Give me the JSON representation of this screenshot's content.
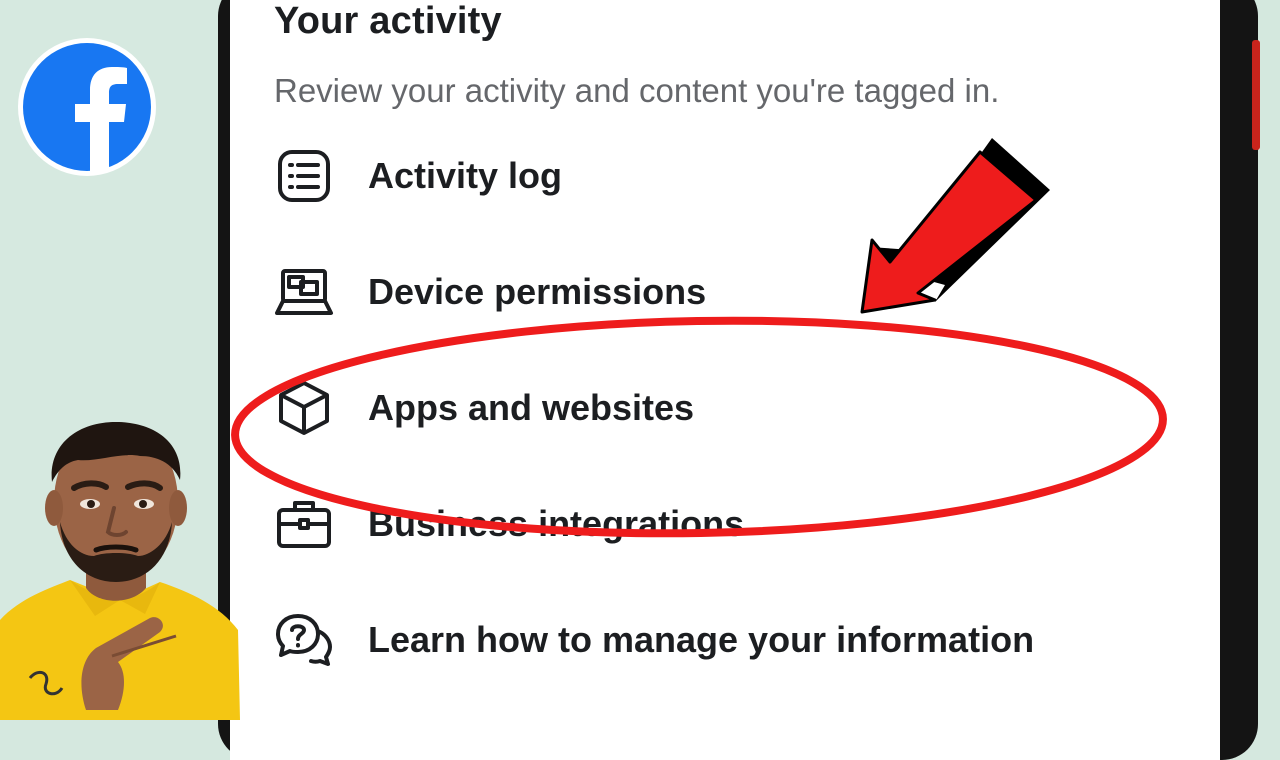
{
  "section": {
    "title": "Your activity",
    "subtitle": "Review your activity and content you're tagged in."
  },
  "menu": {
    "items": [
      {
        "label": "Activity log",
        "icon": "list-icon"
      },
      {
        "label": "Device permissions",
        "icon": "laptop-icon"
      },
      {
        "label": "Apps and websites",
        "icon": "cube-icon"
      },
      {
        "label": "Business integrations",
        "icon": "briefcase-icon"
      },
      {
        "label": "Learn how to manage your information",
        "icon": "question-chat-icon"
      }
    ]
  },
  "overlay": {
    "logo": "facebook-logo",
    "highlighted_item": "Apps and websites",
    "accent_color": "#ee1c1c",
    "brand_color": "#1877f2"
  }
}
